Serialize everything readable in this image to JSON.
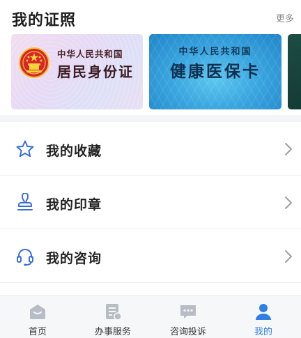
{
  "header": {
    "title": "我的证照",
    "more_label": "更多"
  },
  "cards": [
    {
      "id": "id-card",
      "line1": "中华人民共和国",
      "line2": "居民身份证"
    },
    {
      "id": "health-card",
      "line1": "中华人民共和国",
      "line2": "健康医保卡"
    }
  ],
  "menu": [
    {
      "label": "我的收藏",
      "icon": "star-icon"
    },
    {
      "label": "我的印章",
      "icon": "stamp-icon"
    },
    {
      "label": "我的咨询",
      "icon": "headset-icon"
    }
  ],
  "tabbar": {
    "tabs": [
      {
        "label": "首页",
        "icon": "home-icon",
        "active": false
      },
      {
        "label": "办事服务",
        "icon": "document-icon",
        "active": false
      },
      {
        "label": "咨询投诉",
        "icon": "chat-icon",
        "active": false
      },
      {
        "label": "我的",
        "icon": "person-icon",
        "active": true
      }
    ]
  },
  "colors": {
    "accent": "#2f7fe4",
    "icon_blue": "#3a6fd8",
    "inactive_icon": "#b8bcc4"
  }
}
